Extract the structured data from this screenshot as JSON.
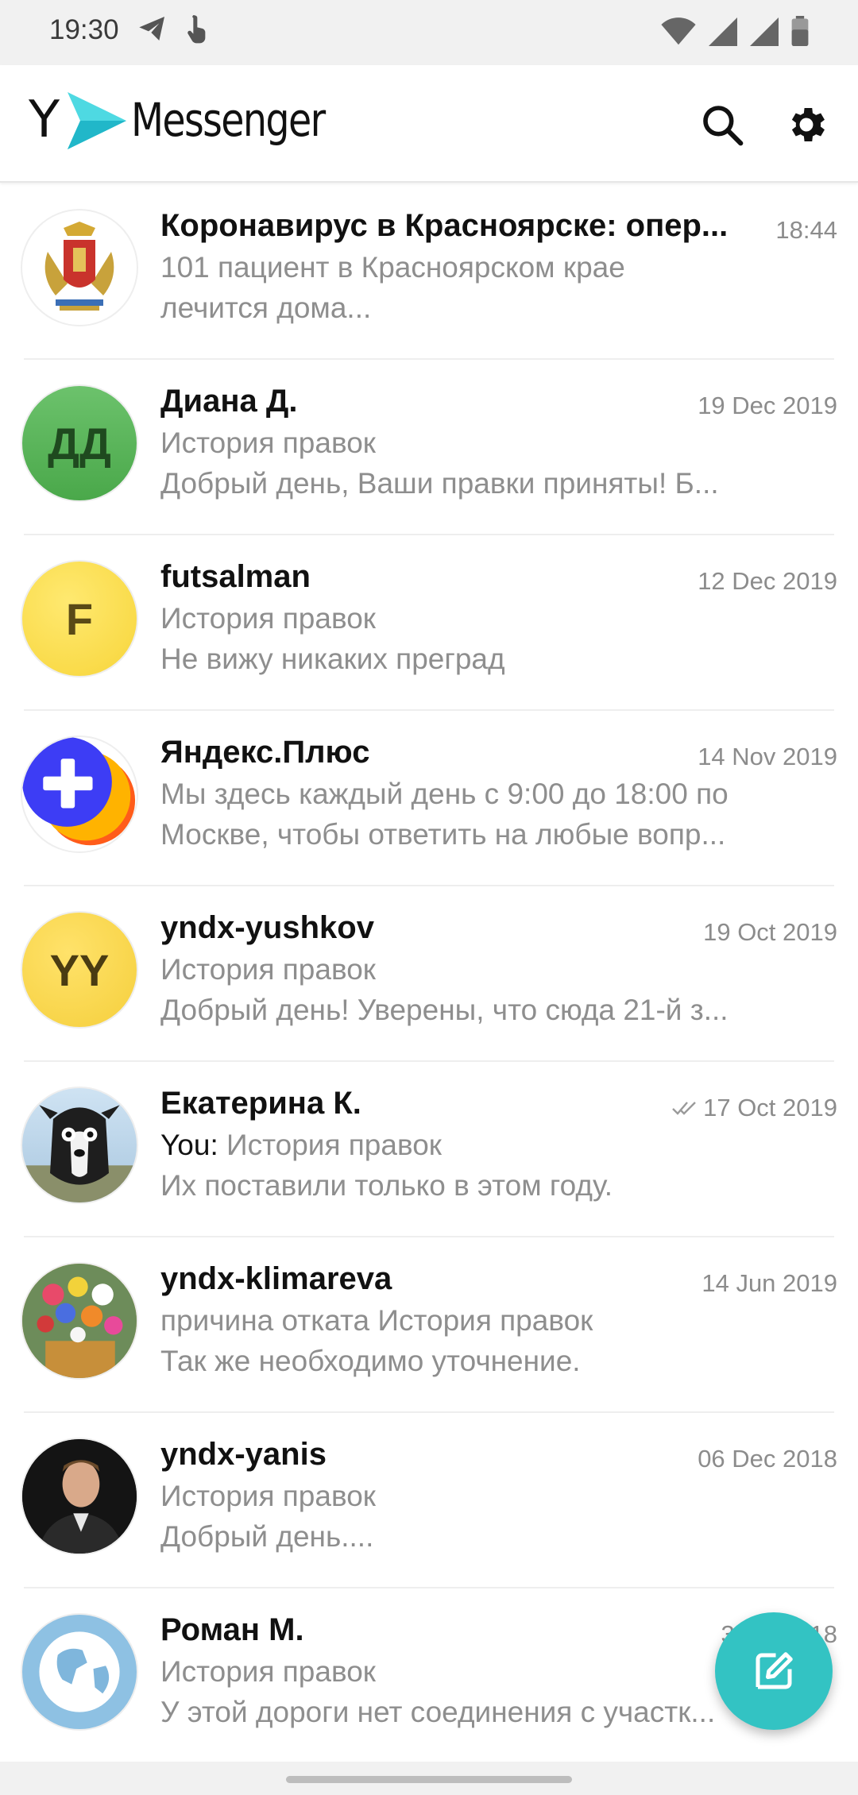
{
  "status_bar": {
    "time": "19:30",
    "left_icons": [
      "telegram-icon",
      "hand-touch-icon"
    ],
    "right_icons": [
      "wifi-icon",
      "signal-icon",
      "signal-icon",
      "battery-icon"
    ]
  },
  "header": {
    "logo_letter": "Y",
    "logo_text": "Messenger",
    "search_icon": "search-icon",
    "settings_icon": "gear-icon"
  },
  "chats": [
    {
      "name": "Коронавирус в Красноярске: опер...",
      "date": "18:44",
      "line1": "101 пациент в Красноярском крае",
      "line2": "лечится дома...",
      "avatar_text": "",
      "avatar_kind": "emblem"
    },
    {
      "name": "Диана Д.",
      "date": "19 Dec 2019",
      "line1": "История правок",
      "line2": "Добрый день, Ваши правки приняты! Б...",
      "avatar_text": "ДД",
      "avatar_kind": "green"
    },
    {
      "name": "futsalman",
      "date": "12 Dec 2019",
      "line1": "История правок",
      "line2": "Не вижу никаких преград",
      "avatar_text": "F",
      "avatar_kind": "yellow"
    },
    {
      "name": "Яндекс.Плюс",
      "date": "14 Nov 2019",
      "line1": "Мы здесь каждый день с 9:00 до 18:00 по",
      "line2": "Москве, чтобы ответить на любые вопр...",
      "avatar_text": "",
      "avatar_kind": "plus"
    },
    {
      "name": "yndx-yushkov",
      "date": "19 Oct 2019",
      "line1": "История правок",
      "line2": "Добрый день! Уверены, что сюда 21-й з...",
      "avatar_text": "YY",
      "avatar_kind": "yellow"
    },
    {
      "name": "Екатерина К.",
      "date": "17 Oct 2019",
      "line1_prefix": "You:",
      "line1": " История правок",
      "line2": "Их поставили только в этом году.",
      "avatar_text": "",
      "avatar_kind": "dog",
      "read_receipt": "double-check-icon"
    },
    {
      "name": "yndx-klimareva",
      "date": "14 Jun 2019",
      "line1": "причина отката История правок",
      "line2": "Так же необходимо уточнение.",
      "avatar_text": "",
      "avatar_kind": "flowers"
    },
    {
      "name": "yndx-yanis",
      "date": "06 Dec 2018",
      "line1": "История правок",
      "line2": "Добрый день....",
      "avatar_text": "",
      "avatar_kind": "person"
    },
    {
      "name": "Роман М.",
      "date": "30 ... 2018",
      "line1": "История правок",
      "line2": "У этой дороги нет соединения с участк...",
      "avatar_text": "",
      "avatar_kind": "globe"
    }
  ],
  "fab": {
    "icon": "compose-icon"
  },
  "colors": {
    "accent": "#33c3c3",
    "green_avatar": "#5cb85c",
    "yellow_avatar": "#fde04f",
    "plus_blue": "#3d3df5"
  }
}
